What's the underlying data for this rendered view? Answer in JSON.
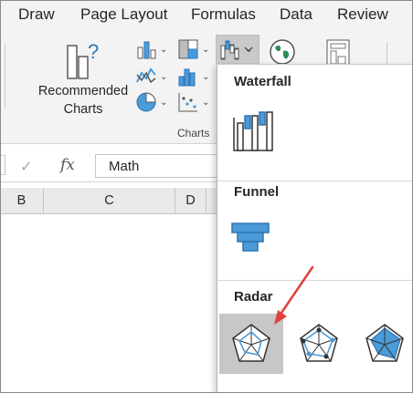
{
  "tabs": [
    "Draw",
    "Page Layout",
    "Formulas",
    "Data",
    "Review"
  ],
  "ribbon": {
    "recommended_line1": "Recommended",
    "recommended_line2": "Charts",
    "group_label": "Charts"
  },
  "formula_bar": {
    "fx": "fx",
    "value": "Math"
  },
  "columns": [
    "B",
    "C",
    "D"
  ],
  "dropdown": {
    "sections": [
      {
        "title": "Waterfall",
        "items": [
          "waterfall-chart"
        ]
      },
      {
        "title": "Funnel",
        "items": [
          "funnel-chart"
        ]
      },
      {
        "title": "Radar",
        "items": [
          "radar-chart",
          "radar-with-markers-chart",
          "filled-radar-chart"
        ]
      }
    ],
    "selected": "radar-chart"
  },
  "colors": {
    "accent_blue": "#4a9bd8",
    "annotation_arrow": "#e0413a",
    "ribbon_bg": "#f3f3f3"
  }
}
